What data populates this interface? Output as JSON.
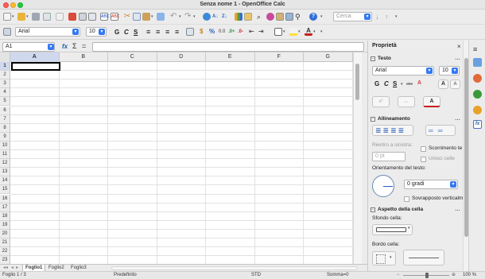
{
  "window": {
    "title": "Senza nome 1 - OpenOffice Calc"
  },
  "toolbar": {
    "search_placeholder": "Cerca",
    "font_name": "Arial",
    "font_size": "10",
    "bold": "G",
    "italic": "C",
    "underline": "S"
  },
  "formula_bar": {
    "name_box": "A1",
    "function_wizard": "fx",
    "sum": "Σ",
    "equals": "="
  },
  "grid": {
    "columns": [
      "A",
      "B",
      "C",
      "D",
      "E",
      "F",
      "G"
    ],
    "rows": [
      "1",
      "2",
      "3",
      "4",
      "5",
      "6",
      "7",
      "8",
      "9",
      "10",
      "11",
      "12",
      "13",
      "14",
      "15",
      "16",
      "17",
      "18",
      "19",
      "20",
      "21",
      "22",
      "23"
    ],
    "active_cell": "A1"
  },
  "sheet_tabs": [
    "Foglio1",
    "Foglio2",
    "Foglio3"
  ],
  "statusbar": {
    "sheet_info": "Foglio 1 / 3",
    "page_style": "Predefinito",
    "selection_mode": "STD",
    "sum_text": "Somma=0",
    "zoom": "100 %"
  },
  "sidebar": {
    "title": "Proprietà",
    "close": "×",
    "text_section": {
      "title": "Testo",
      "font_name": "Arial",
      "font_size": "10",
      "bold": "G",
      "italic": "C",
      "underline": "S"
    },
    "alignment_section": {
      "title": "Allineamento",
      "indent_label": "Rientro a sinistra:",
      "indent_value": "0 pt",
      "wrap_label": "Scorrimento te",
      "merge_label": "Unisci celle",
      "orientation_label": "Orientamento del testo:",
      "degrees_value": "0 gradi",
      "stacked_label": "Sovrapposto verticalm"
    },
    "cell_section": {
      "title": "Aspetto della cella",
      "background_label": "Sfondo cella:",
      "border_label": "Bordo cella:"
    }
  },
  "colors": {
    "accent": "#3478f6",
    "selection": "#cfd8ec"
  }
}
